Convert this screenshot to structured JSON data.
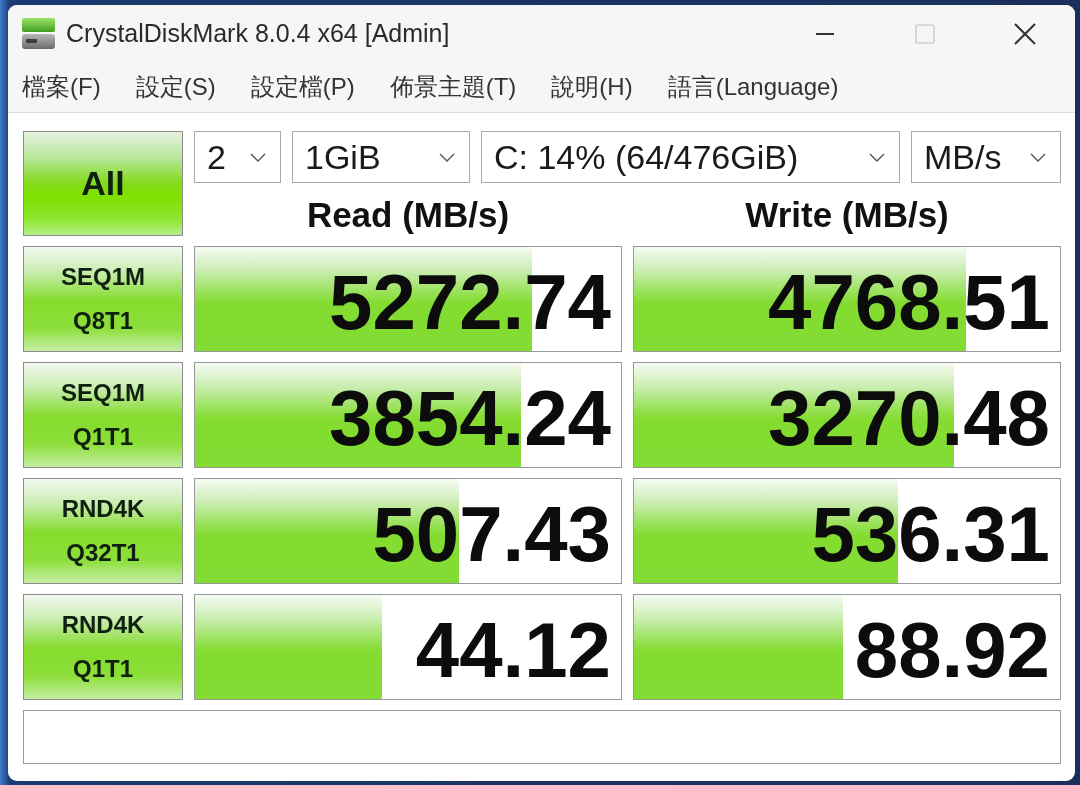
{
  "window": {
    "title": "CrystalDiskMark 8.0.4 x64 [Admin]"
  },
  "window_buttons": [
    {
      "kind": "minimize",
      "disabled": false
    },
    {
      "kind": "maximize",
      "disabled": true
    },
    {
      "kind": "close",
      "disabled": false
    }
  ],
  "menu": [
    "檔案(F)",
    "設定(S)",
    "設定檔(P)",
    "佈景主題(T)",
    "說明(H)",
    "語言(Language)"
  ],
  "all_button": "All",
  "selectors": [
    {
      "value": "2"
    },
    {
      "value": "1GiB"
    },
    {
      "value": "C: 14% (64/476GiB)"
    },
    {
      "value": "MB/s"
    }
  ],
  "columns": [
    "Read (MB/s)",
    "Write (MB/s)"
  ],
  "tests": [
    {
      "name": "SEQ1M",
      "params": "Q8T1",
      "read": {
        "value": "5272.74",
        "level": 0.79
      },
      "write": {
        "value": "4768.51",
        "level": 0.78
      }
    },
    {
      "name": "SEQ1M",
      "params": "Q1T1",
      "read": {
        "value": "3854.24",
        "level": 0.765
      },
      "write": {
        "value": "3270.48",
        "level": 0.75
      }
    },
    {
      "name": "RND4K",
      "params": "Q32T1",
      "read": {
        "value": "507.43",
        "level": 0.62
      },
      "write": {
        "value": "536.31",
        "level": 0.62
      }
    },
    {
      "name": "RND4K",
      "params": "Q1T1",
      "read": {
        "value": "44.12",
        "level": 0.44
      },
      "write": {
        "value": "88.92",
        "level": 0.49
      }
    }
  ]
}
